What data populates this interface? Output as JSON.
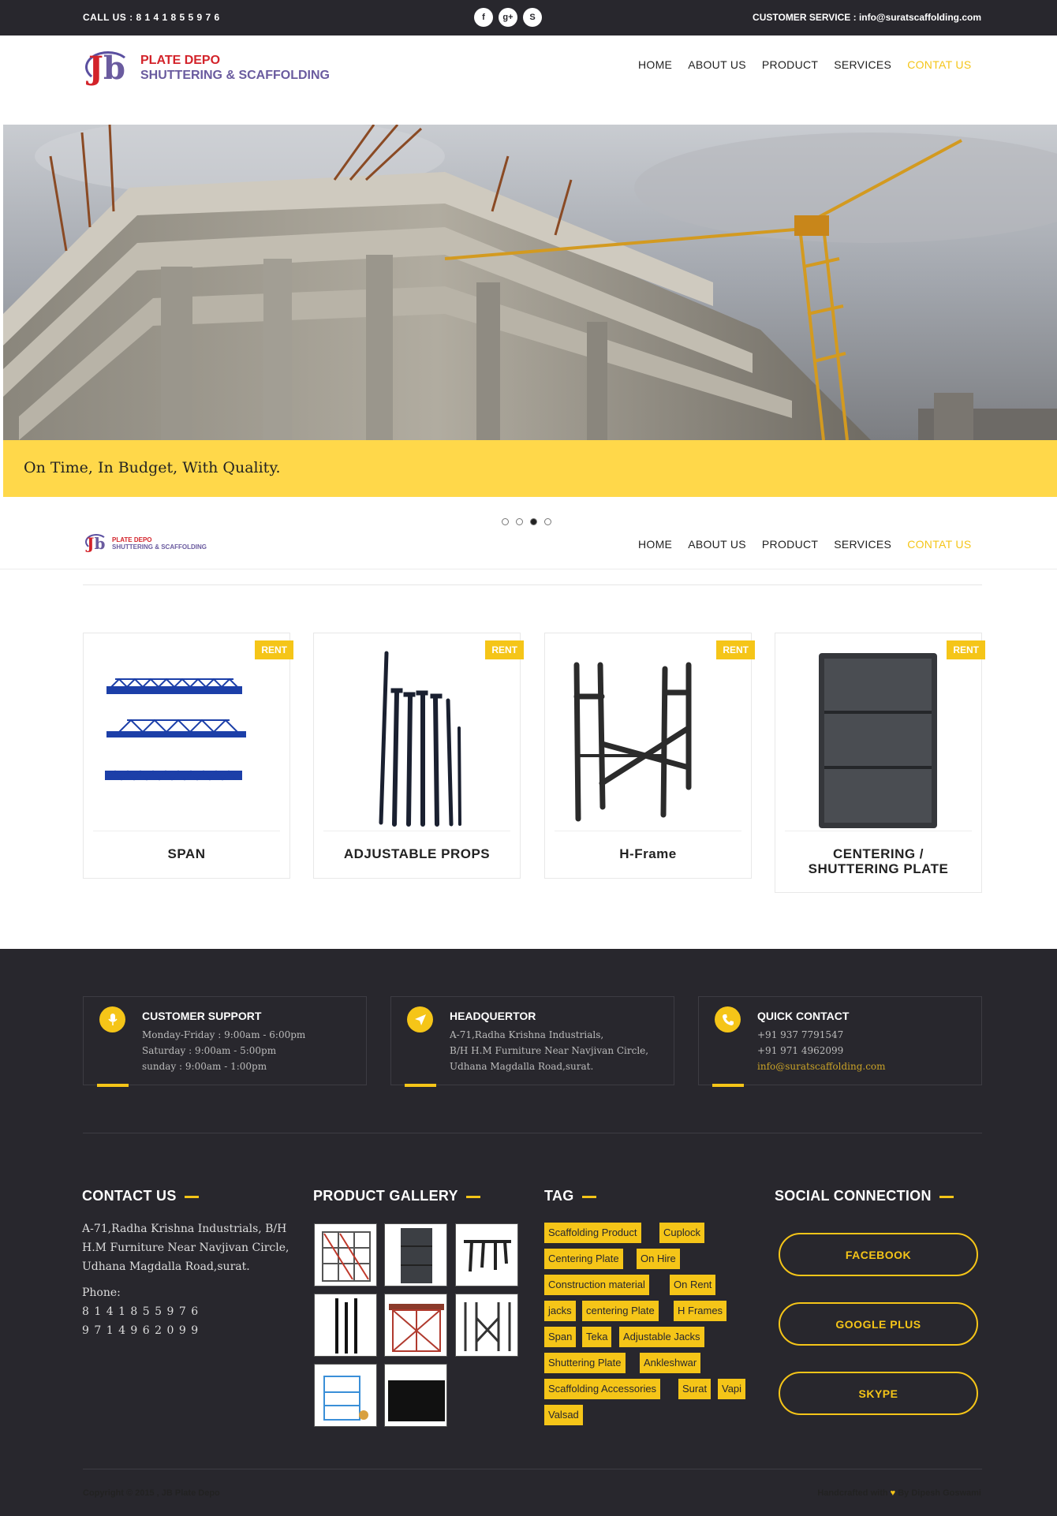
{
  "topbar": {
    "call": "CALL US : 8 1 4 1 8 5 5 9 7 6",
    "customer_service": "CUSTOMER SERVICE : info@suratscaffolding.com",
    "social": [
      {
        "icon": "facebook-icon",
        "glyph": "f"
      },
      {
        "icon": "google-plus-icon",
        "glyph": "g+"
      },
      {
        "icon": "skype-icon",
        "glyph": "S"
      }
    ]
  },
  "logo": {
    "mark_j": "J",
    "mark_b": "b",
    "line1": "PLATE DEPO",
    "line2": "SHUTTERING & SCAFFOLDING"
  },
  "nav": {
    "items": [
      "HOME",
      "ABOUT US",
      "PRODUCT",
      "SERVICES",
      "CONTAT US"
    ],
    "active": "CONTAT US"
  },
  "hero": {
    "tagline": "On Time, In Budget, With Quality.",
    "slides": 4,
    "active_slide": 3
  },
  "products": [
    {
      "badge": "RENT",
      "name": "SPAN",
      "image": "span-truss-image"
    },
    {
      "badge": "RENT",
      "name": "ADJUSTABLE PROPS",
      "image": "adjustable-props-image"
    },
    {
      "badge": "RENT",
      "name": "H-Frame",
      "image": "h-frame-image"
    },
    {
      "badge": "RENT",
      "name": "CENTERING / SHUTTERING PLATE",
      "image": "shuttering-plate-image"
    }
  ],
  "info": {
    "support": {
      "title": "CUSTOMER SUPPORT",
      "icon": "microphone-icon",
      "lines": [
        "Monday-Friday : 9:00am - 6:00pm",
        "Saturday : 9:00am - 5:00pm",
        "sunday : 9:00am - 1:00pm"
      ]
    },
    "hq": {
      "title": "HEADQUERTOR",
      "icon": "location-arrow-icon",
      "lines": [
        "A-71,Radha Krishna Industrials,",
        "B/H H.M Furniture Near Navjivan Circle,",
        "Udhana Magdalla Road,surat."
      ]
    },
    "quick": {
      "title": "QUICK CONTACT",
      "icon": "phone-icon",
      "lines": [
        "+91 937 7791547",
        "+91 971 4962099"
      ],
      "email": "info@suratscaffolding.com"
    }
  },
  "footer": {
    "contact_title": "CONTACT US",
    "address": [
      "A-71,Radha Krishna Industrials, B/H",
      "H.M Furniture Near Navjivan Circle,",
      "Udhana Magdalla Road,surat."
    ],
    "phone_label": "Phone:",
    "phones": [
      "8 1 4 1 8 5 5 9 7 6",
      "9 7 1 4 9 6 2 0 9 9"
    ],
    "gallery_title": "PRODUCT GALLERY",
    "tag_title": "TAG",
    "tags": [
      "Scaffolding Product",
      "Cuplock",
      "Centering Plate",
      "On Hire",
      "Construction material",
      "On Rent",
      "jacks",
      "centering Plate",
      "H Frames",
      "Span",
      "Teka",
      "Adjustable Jacks",
      "Shuttering Plate",
      "Ankleshwar",
      "Scaffolding Accessories",
      "Surat",
      "Vapi",
      "Valsad"
    ],
    "social_title": "SOCIAL CONNECTION",
    "social_buttons": [
      "FACEBOOK",
      "GOOGLE PLUS",
      "SKYPE"
    ],
    "copyright": "Copyright © 2015 , JB Plate Depo",
    "handcrafted": "Handcrafted with",
    "heart": "♥",
    "author": "By Dipesh Goswami"
  },
  "colors": {
    "accent": "#f5c518",
    "dark": "#28272d",
    "tagline_bg": "#ffd84a",
    "logo_red": "#d3232a",
    "logo_purple": "#6a5b9f"
  }
}
